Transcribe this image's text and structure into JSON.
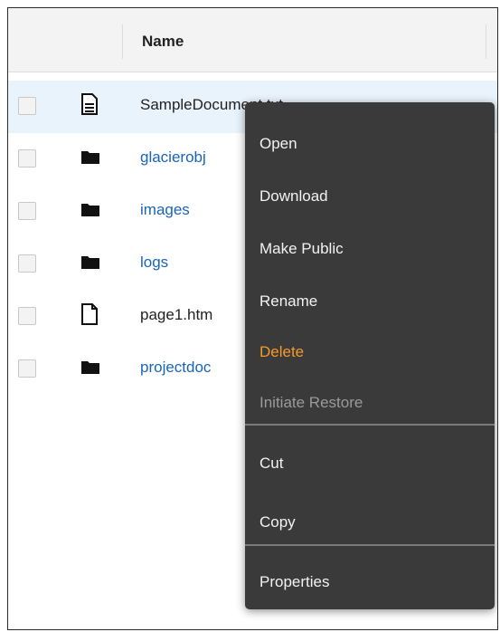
{
  "table": {
    "header_name": "Name",
    "rows": [
      {
        "label": "SampleDocument.txt",
        "icon": "document-icon",
        "type": "file",
        "selected": true
      },
      {
        "label": "glacierobj",
        "icon": "folder-icon",
        "type": "folder"
      },
      {
        "label": "images",
        "icon": "folder-icon",
        "type": "folder"
      },
      {
        "label": "logs",
        "icon": "folder-icon",
        "type": "folder"
      },
      {
        "label": "page1.htm",
        "icon": "blank-file-icon",
        "type": "file"
      },
      {
        "label": "projectdoc",
        "icon": "folder-icon",
        "type": "folder"
      }
    ]
  },
  "context_menu": {
    "items": [
      {
        "label": "Open"
      },
      {
        "label": "Download"
      },
      {
        "label": "Make Public"
      },
      {
        "label": "Rename"
      },
      {
        "label": "Delete",
        "color": "#f39a2a"
      },
      {
        "label": "Initiate Restore",
        "disabled": true
      },
      {
        "label": "Cut"
      },
      {
        "label": "Copy"
      },
      {
        "label": "Properties"
      }
    ]
  },
  "colors": {
    "link": "#1a64b8",
    "selected_row": "#e9f3fc",
    "menu_bg": "#3a3a3a",
    "delete": "#f39a2a"
  }
}
